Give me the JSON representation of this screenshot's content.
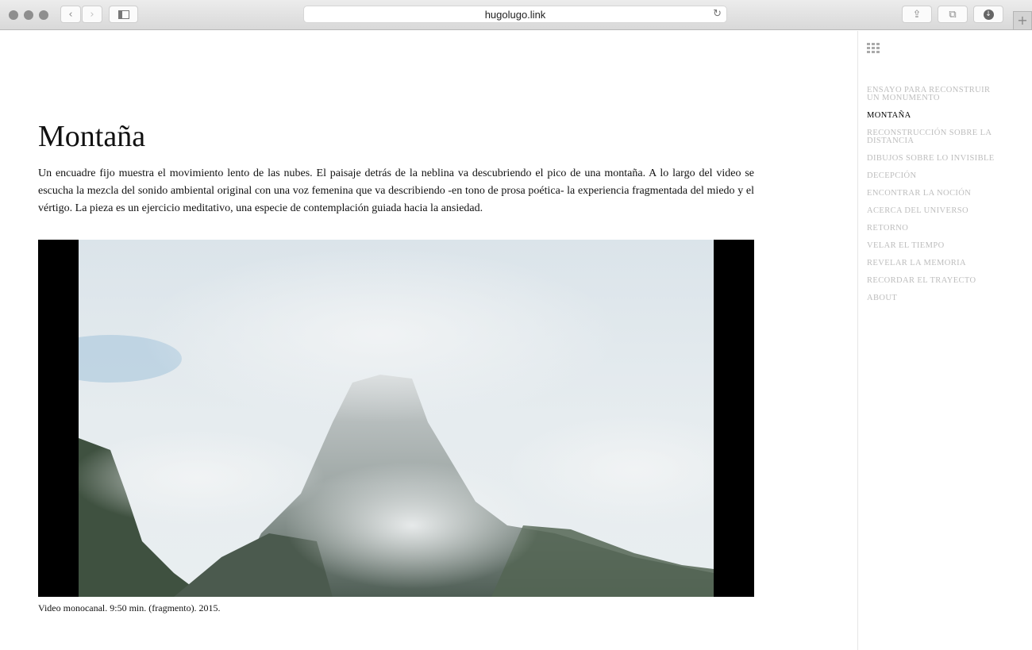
{
  "browser": {
    "url": "hugolugo.link",
    "icons": {
      "back": "chevron-left-icon",
      "forward": "chevron-right-icon",
      "sidebar": "sidebar-icon",
      "reload": "reload-icon",
      "share": "share-icon",
      "tabs": "tabs-icon",
      "downloads": "download-icon",
      "new_tab": "plus-icon"
    }
  },
  "sidebar": {
    "icon": "grid-icon",
    "items": [
      {
        "label": "ENSAYO PARA RECONSTRUIR UN MONUMENTO"
      },
      {
        "label": "MONTAÑA",
        "active": true
      },
      {
        "label": "RECONSTRUCCIÓN SOBRE LA DISTANCIA"
      },
      {
        "label": "DIBUJOS SOBRE LO INVISIBLE"
      },
      {
        "label": "DECEPCIÓN"
      },
      {
        "label": "ENCONTRAR LA NOCIÓN"
      },
      {
        "label": "ACERCA DEL UNIVERSO"
      },
      {
        "label": "RETORNO"
      },
      {
        "label": "VELAR EL TIEMPO"
      },
      {
        "label": "REVELAR LA MEMORIA"
      },
      {
        "label": "RECORDAR EL TRAYECTO"
      },
      {
        "label": "ABOUT"
      }
    ]
  },
  "main": {
    "title": "Montaña",
    "description": "Un encuadre fijo muestra el movimiento lento de las nubes. El paisaje detrás de la neblina va descubriendo el pico de una montaña. A lo largo del video se escucha la mezcla del sonido ambiental original con una voz femenina que va describiendo -en tono de prosa poética- la experiencia fragmentada del miedo y el vértigo. La pieza es un ejercicio meditativo, una especie de contemplación guiada hacia la ansiedad.",
    "caption": "Video monocanal. 9:50 min. (fragmento). 2015."
  }
}
